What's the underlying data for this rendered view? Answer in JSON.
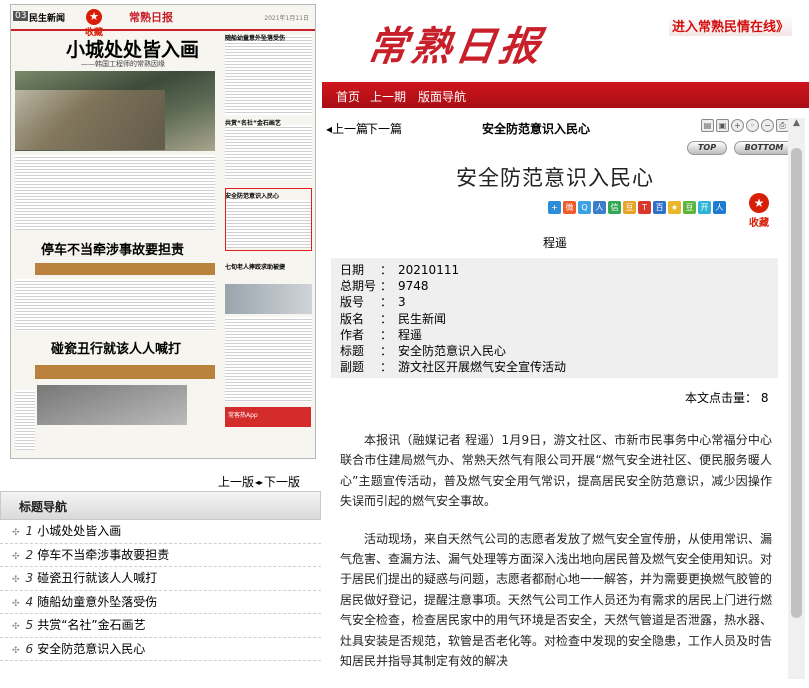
{
  "thumb": {
    "page_no": "03",
    "section": "民生新闻",
    "logo": "常熟日报",
    "date": "2021年1月11日",
    "headline": "小城处处皆入画",
    "subhead": "——韩国工程师的常熟因缘",
    "headline2": "停车不当牵涉事故要担责",
    "headline3": "碰瓷丑行就该人人喊打",
    "right_titles": [
      "随船幼童意外坠落受伤",
      "共赏“名社”金石画艺",
      "安全防范意识入民心",
      "七旬老人摔跤求助被捷"
    ],
    "footer": "常客热App"
  },
  "favorite_label": "收藏",
  "pager": {
    "prev": "上一版",
    "next": "下一版"
  },
  "nav": {
    "title": "标题导航",
    "items": [
      {
        "num": "1",
        "label": "小城处处皆入画"
      },
      {
        "num": "2",
        "label": "停车不当牵涉事故要担责"
      },
      {
        "num": "3",
        "label": "碰瓷丑行就该人人喊打"
      },
      {
        "num": "4",
        "label": "随船幼童意外坠落受伤"
      },
      {
        "num": "5",
        "label": "共赏“名社”金石画艺"
      },
      {
        "num": "6",
        "label": "安全防范意识入民心"
      }
    ]
  },
  "site_logo": "常熟日报",
  "enter_link": "进入常熟民情在线》",
  "top_nav": {
    "home": "首页",
    "prev_issue": "上一期",
    "layout_nav": "版面导航"
  },
  "article_bar": {
    "prev": "上一篇",
    "next": "下一篇",
    "title": "安全防范意识入民心",
    "top": "TOP",
    "bottom": "BOTTOM"
  },
  "article": {
    "title": "安全防范意识入民心",
    "author": "程遥",
    "meta": [
      {
        "key": "日期",
        "value": "20210111"
      },
      {
        "key": "总期号",
        "value": "9748"
      },
      {
        "key": "版号",
        "value": "3"
      },
      {
        "key": "版名",
        "value": "民生新闻"
      },
      {
        "key": "作者",
        "value": "程遥"
      },
      {
        "key": "标题",
        "value": "安全防范意识入民心"
      },
      {
        "key": "副题",
        "value": "游文社区开展燃气安全宣传活动"
      }
    ],
    "hits_label": "本文点击量：",
    "hits": "8",
    "paragraphs": [
      "本报讯（融媒记者 程遥）1月9日，游文社区、市新市民事务中心常福分中心联合市住建局燃气办、常熟天然气有限公司开展“燃气安全进社区、便民服务暖人心”主题宣传活动，普及燃气安全用气常识，提高居民安全防范意识，减少因操作失误而引起的燃气安全事故。",
      "活动现场，来自天然气公司的志愿者发放了燃气安全宣传册，从使用常识、漏气危害、查漏方法、漏气处理等方面深入浅出地向居民普及燃气安全使用知识。对于居民们提出的疑惑与问题，志愿者都耐心地一一解答，并为需要更换燃气胶管的居民做好登记，提醒注意事项。天然气公司工作人员还为有需求的居民上门进行燃气安全检查，检查居民家中的用气环境是否安全，天然气管道是否泄露，热水器、灶具安装是否规范，软管是否老化等。对检查中发现的安全隐患，工作人员及时告知居民并指导其制定有效的解决"
    ]
  }
}
